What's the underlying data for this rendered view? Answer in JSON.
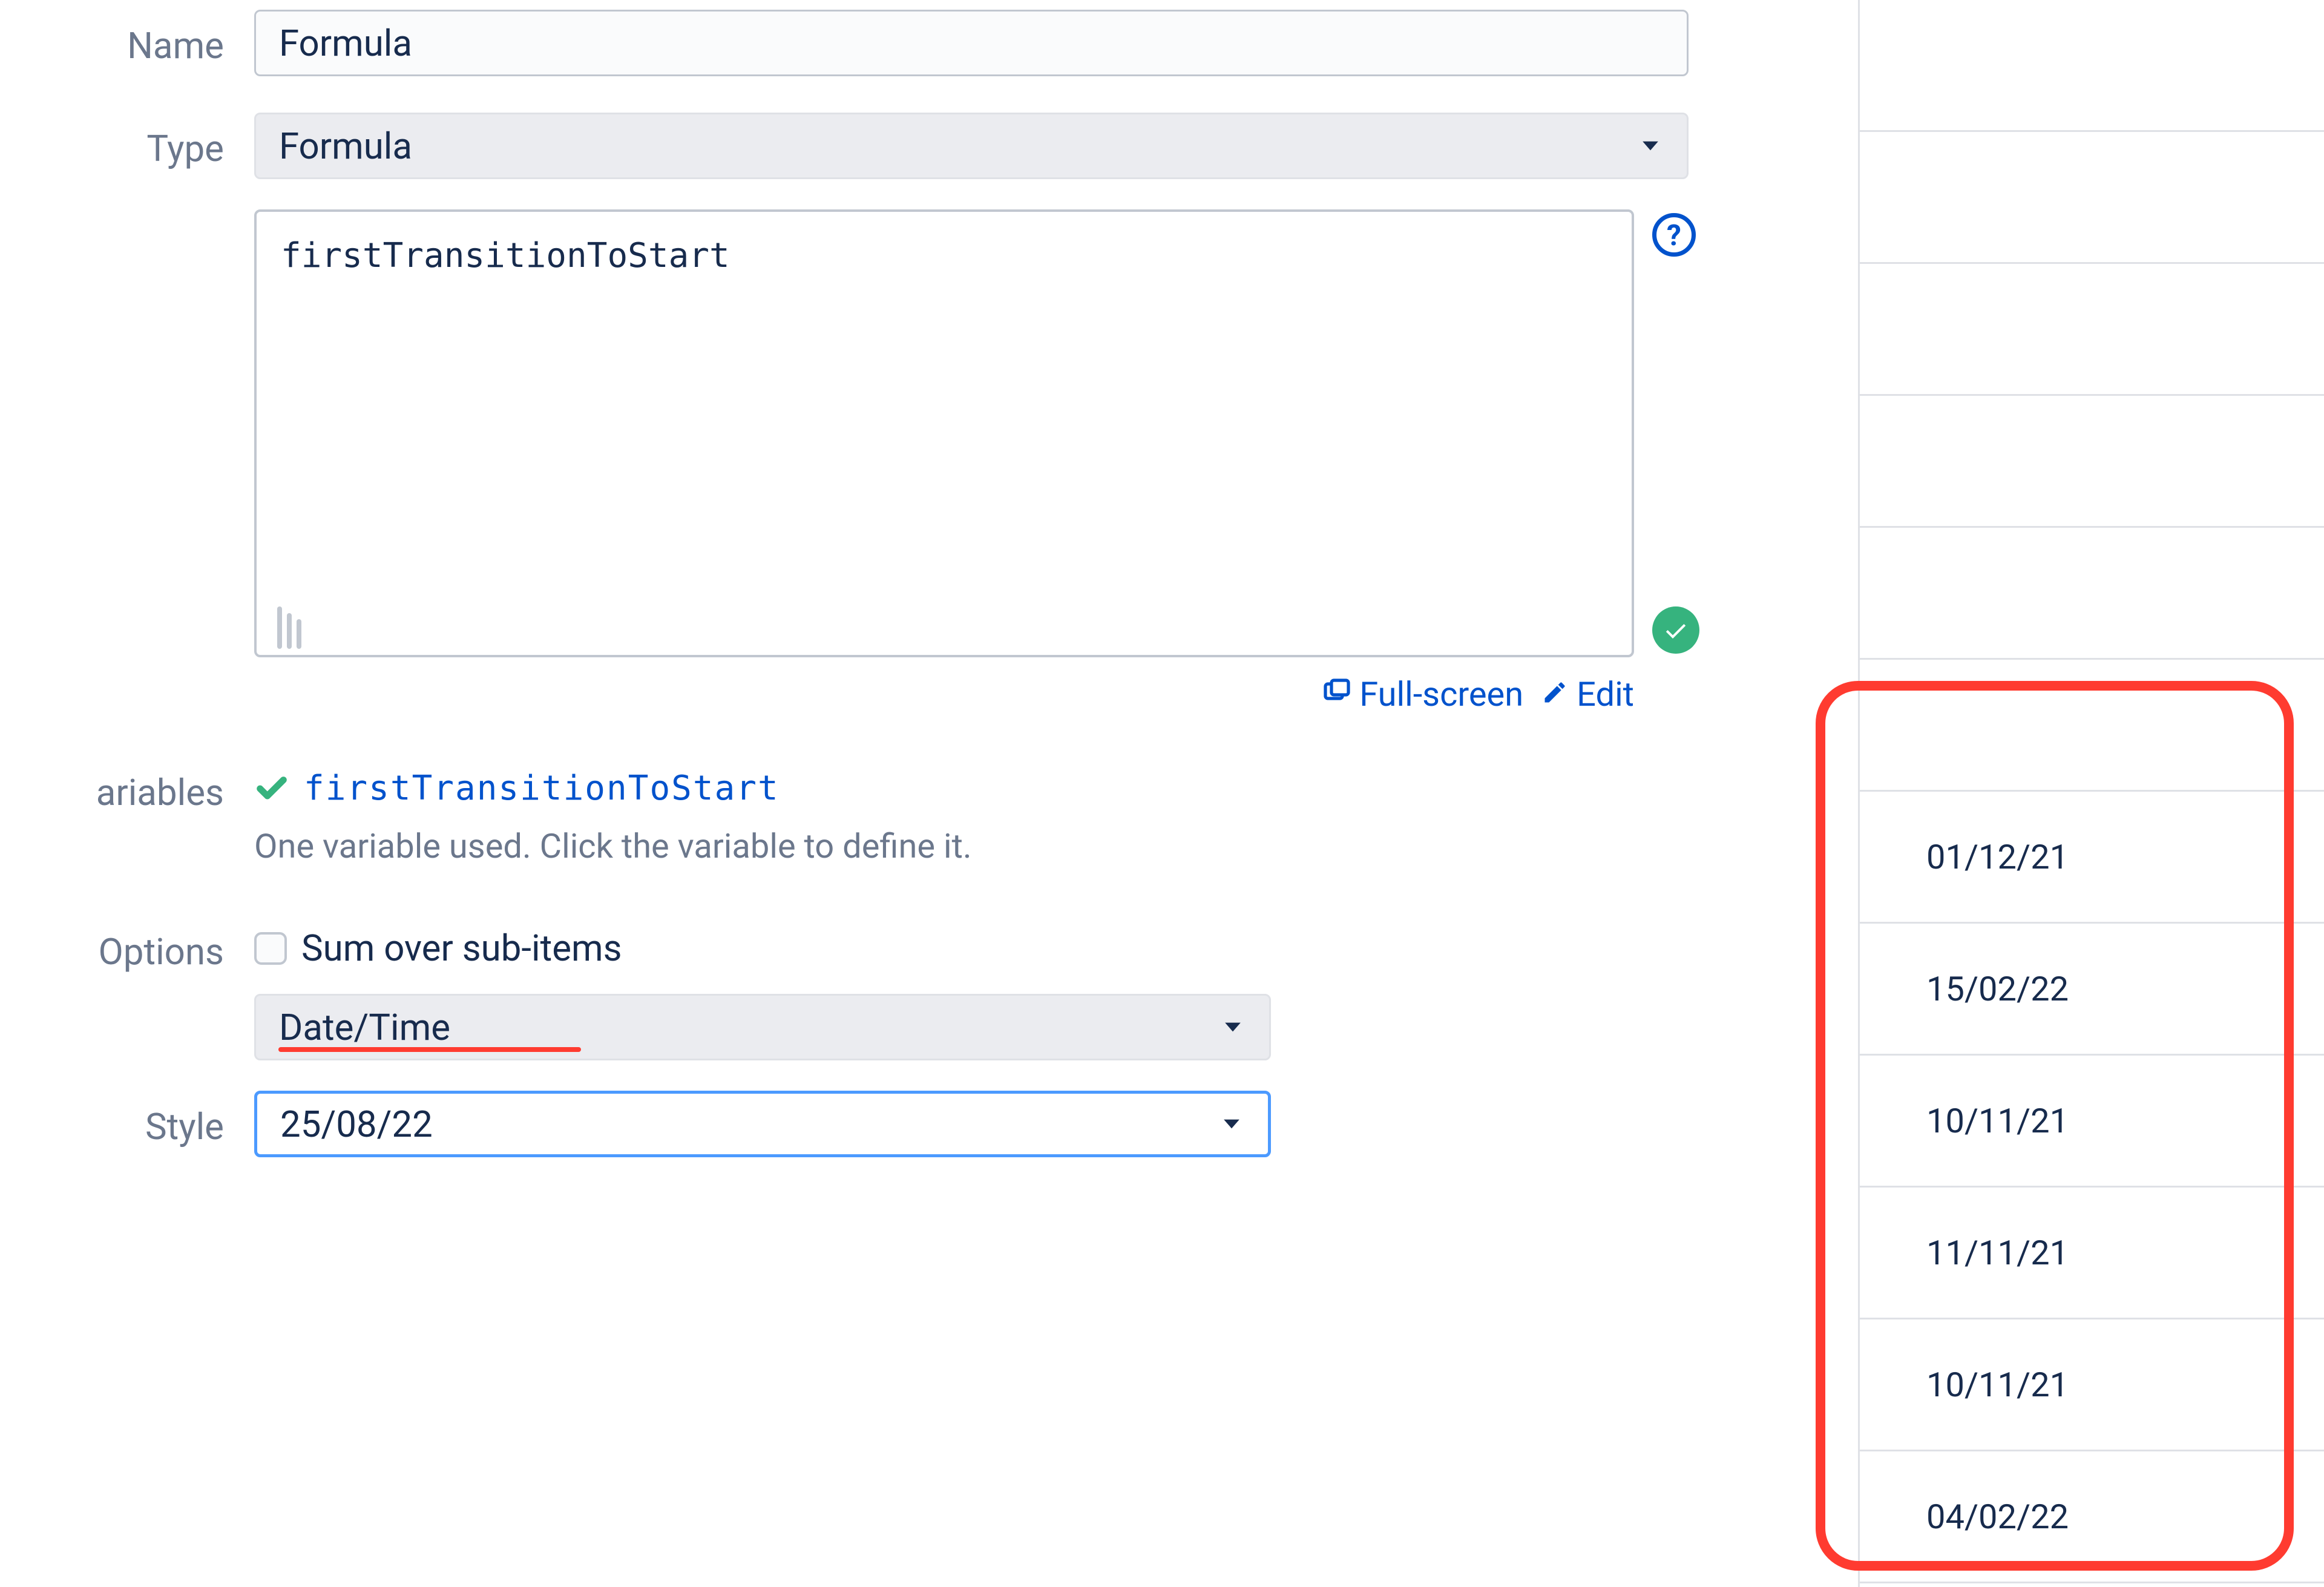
{
  "form": {
    "name_label": "Name",
    "name_value": "Formula",
    "type_label": "Type",
    "type_value": "Formula",
    "formula_text": "firstTransitionToStart",
    "fullscreen_label": "Full-screen",
    "edit_label": "Edit",
    "variables_label": "ariables",
    "variable_name": "firstTransitionToStart",
    "variables_hint": "One variable used. Click the variable to define it.",
    "options_label": "Options",
    "sum_checkbox_label": "Sum over sub-items",
    "format_value": "Date/Time",
    "style_label": "Style",
    "style_value": "25/08/22",
    "help_glyph": "?"
  },
  "table": {
    "dates": [
      "01/12/21",
      "15/02/22",
      "10/11/21",
      "11/11/21",
      "10/11/21",
      "04/02/22"
    ]
  }
}
